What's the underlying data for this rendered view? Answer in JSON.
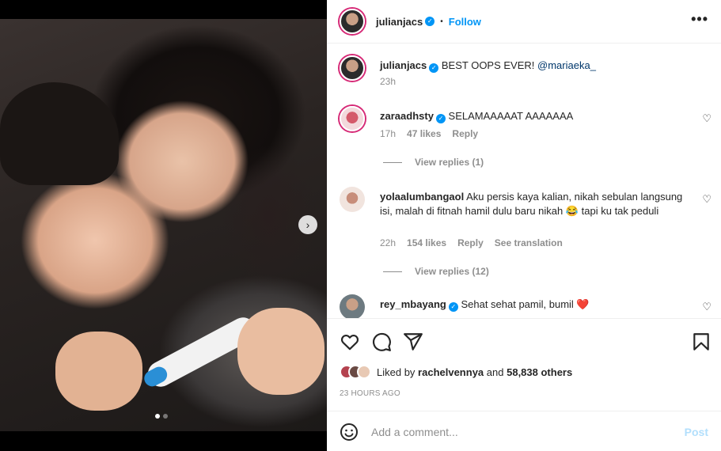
{
  "post": {
    "author": "julianjacs",
    "follow_label": "Follow",
    "separator": "•",
    "more_glyph": "•••"
  },
  "caption": {
    "author": "julianjacs",
    "text": "BEST OOPS EVER!",
    "mention": "@mariaeka_",
    "time": "23h"
  },
  "comments": [
    {
      "user": "zaraadhsty",
      "verified": true,
      "text": "SELAMAAAAAT AAAAAAA",
      "time": "17h",
      "likes": "47 likes",
      "reply": "Reply",
      "view_replies": "View replies (1)"
    },
    {
      "user": "yolaalumbangaol",
      "verified": false,
      "text": "Aku persis kaya kalian, nikah sebulan langsung isi, malah di fitnah hamil dulu baru nikah 😂 tapi ku tak peduli",
      "time": "22h",
      "likes": "154 likes",
      "reply": "Reply",
      "see_translation": "See translation",
      "view_replies": "View replies (12)"
    },
    {
      "user": "rey_mbayang",
      "verified": true,
      "text": "Sehat sehat pamil, bumil ❤️"
    }
  ],
  "likes": {
    "prefix": "Liked by",
    "user": "rachelvennya",
    "joiner": "and",
    "others": "58,838 others"
  },
  "timestamp": "23 HOURS AGO",
  "add_comment": {
    "placeholder": "Add a comment...",
    "post_label": "Post"
  },
  "carousel": {
    "next_glyph": "›",
    "total": 2,
    "current": 1
  },
  "colors": {
    "accent": "#0095f6",
    "post_disabled": "#b2dffc",
    "heart_red": "#ed4956",
    "muted": "#8e8e8e"
  },
  "icons": [
    "heart-icon",
    "comment-icon",
    "share-icon",
    "bookmark-icon",
    "emoji-icon",
    "verified-icon",
    "more-icon",
    "chevron-right-icon"
  ]
}
